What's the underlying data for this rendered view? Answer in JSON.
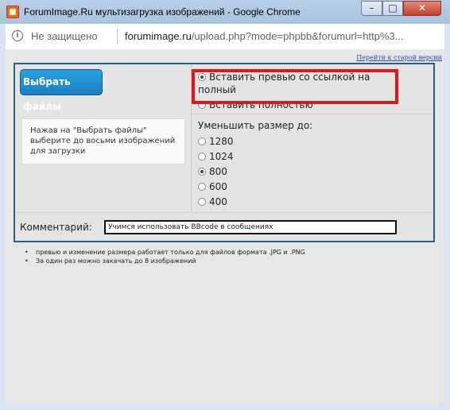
{
  "window": {
    "title": "ForumImage.Ru мультизагрузка изображений - Google Chrome",
    "minimize": "–",
    "maximize": "□",
    "close": "✕"
  },
  "address_bar": {
    "security_label": "Не защищено",
    "url_host": "forumimage.ru",
    "url_rest": "/upload.php?mode=phpbb&forumurl=http%3..."
  },
  "page": {
    "old_version_link": "Перейти к старой версии",
    "choose_files_button": "Выбрать файлы",
    "hint": "Нажав на \"Выбрать файлы\" выберите до восьми изображений для загрузки",
    "insert_options": [
      {
        "label": "Вставить превью со ссылкой на полный",
        "selected": true
      },
      {
        "label": "Вставить полностью",
        "selected": false
      }
    ],
    "resize_label": "Уменьшить размер до:",
    "sizes": [
      {
        "label": "1280",
        "selected": false
      },
      {
        "label": "1024",
        "selected": false
      },
      {
        "label": "800",
        "selected": true
      },
      {
        "label": "600",
        "selected": false
      },
      {
        "label": "400",
        "selected": false
      }
    ],
    "comment_label": "Комментарий:",
    "comment_value": "Учимся использовать BBcode в сообщениях",
    "notes": [
      "превью и изменение размера работает только для файлов формата .JPG и .PNG",
      "За один раз можно закачать до 8 изображений"
    ],
    "highlight_color": "#e0161e"
  }
}
